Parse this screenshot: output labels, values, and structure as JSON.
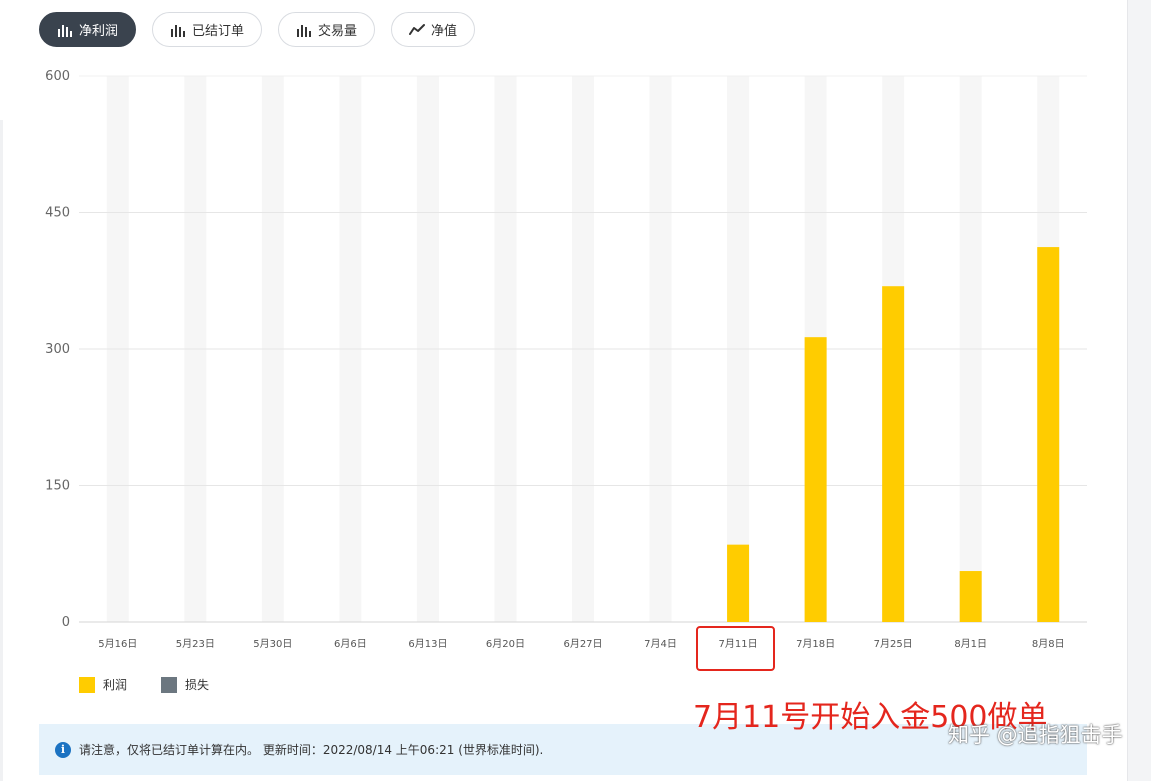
{
  "tabs": [
    {
      "label": "净利润",
      "icon": "bar-chart-icon",
      "active": true
    },
    {
      "label": "已结订单",
      "icon": "bar-chart-icon",
      "active": false
    },
    {
      "label": "交易量",
      "icon": "bar-chart-icon",
      "active": false
    },
    {
      "label": "净值",
      "icon": "line-chart-icon",
      "active": false
    }
  ],
  "chart_data": {
    "type": "bar",
    "categories": [
      "5月16日",
      "5月23日",
      "5月30日",
      "6月6日",
      "6月13日",
      "6月20日",
      "6月27日",
      "7月4日",
      "7月11日",
      "7月18日",
      "7月25日",
      "8月1日",
      "8月8日"
    ],
    "series": [
      {
        "name": "利润",
        "values": [
          0,
          0,
          0,
          0,
          0,
          0,
          0,
          0,
          85,
          313,
          369,
          56,
          412
        ]
      },
      {
        "name": "损失",
        "values": [
          0,
          0,
          0,
          0,
          0,
          0,
          0,
          0,
          0,
          0,
          0,
          0,
          0
        ]
      }
    ],
    "yticks": [
      0,
      150,
      300,
      450,
      600
    ],
    "ylim": [
      0,
      600
    ],
    "grid": true,
    "legend_position": "bottom-left",
    "colors": {
      "profit": "#ffcc00",
      "loss": "#6c7780",
      "column_bg": "#f6f6f6",
      "grid": "#e6e6e6"
    }
  },
  "legend": {
    "profit_label": "利润",
    "loss_label": "损失"
  },
  "notice": {
    "text": "请注意，仅将已结订单计算在内。 更新时间：2022/08/14 上午06:21 (世界标准时间)."
  },
  "annotation": {
    "text": "7月11号开始入金500做单"
  },
  "watermark": {
    "text": "知乎 @追指狙击手"
  }
}
